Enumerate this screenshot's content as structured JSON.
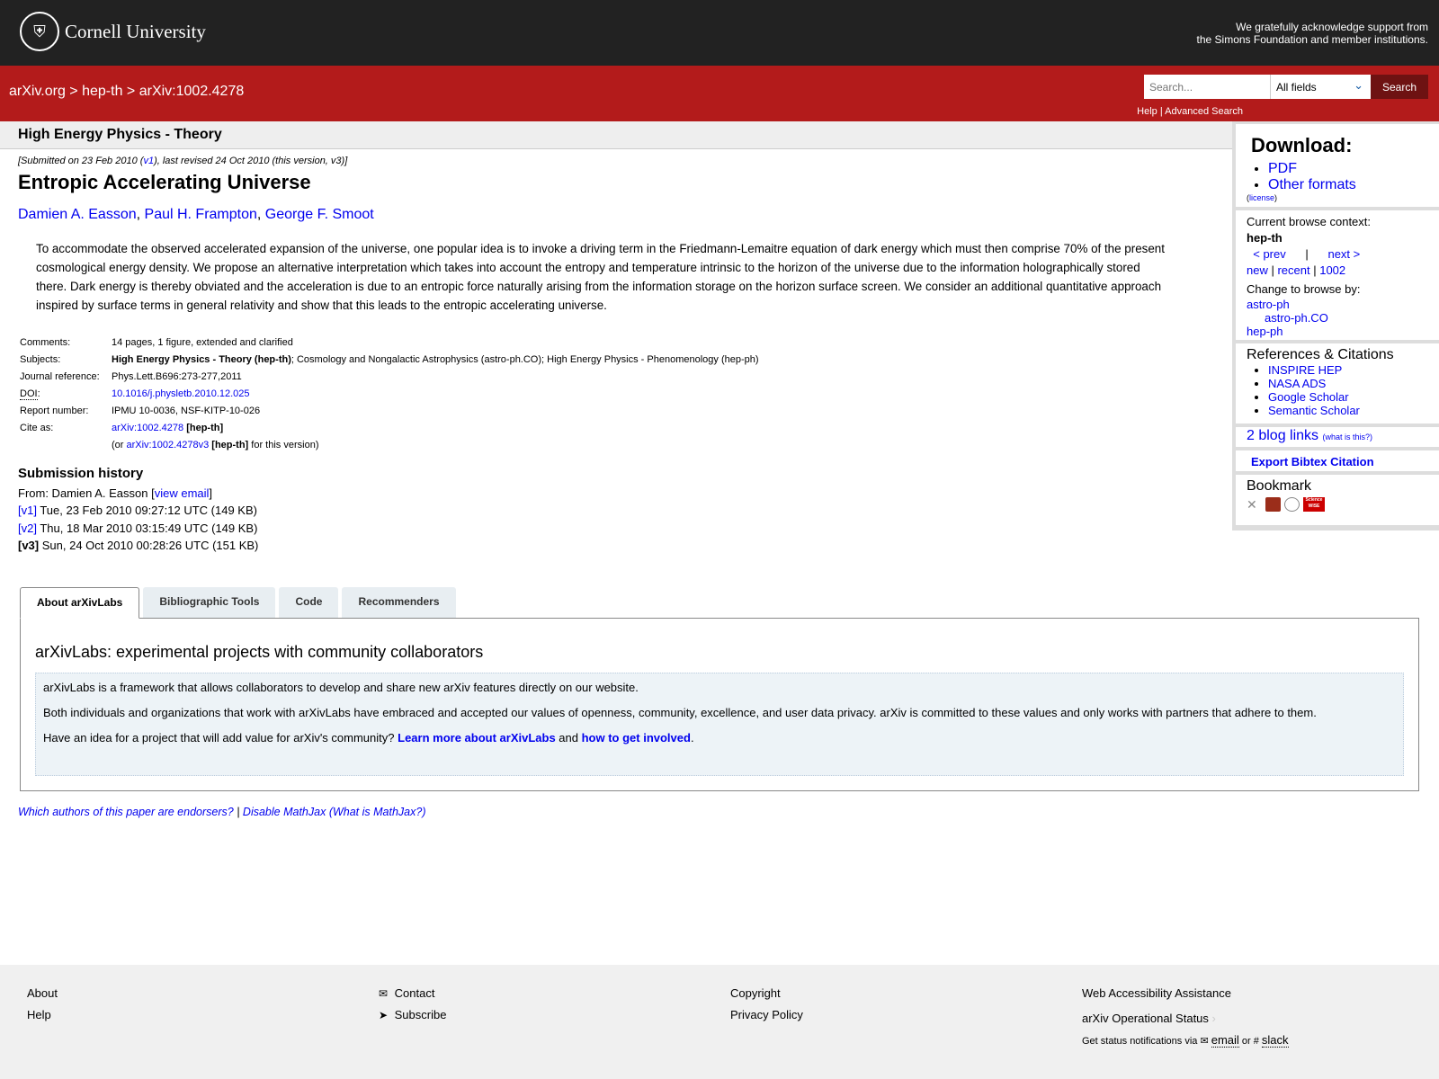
{
  "header": {
    "logo_text": "Cornell University",
    "ack_line1": "We gratefully acknowledge support from",
    "ack_line2": "the Simons Foundation and member institutions."
  },
  "nav": {
    "crumb1": "arXiv.org",
    "crumb2": "hep-th",
    "crumb3": "arXiv:1002.4278",
    "sep": ">",
    "search_placeholder": "Search...",
    "field_select": "All fields",
    "search_button": "Search",
    "help": "Help",
    "advanced": "Advanced Search"
  },
  "paper": {
    "category": "High Energy Physics - Theory",
    "dateline_pre": "[Submitted on 23 Feb 2010 (",
    "dateline_v1": "v1",
    "dateline_post": "), last revised 24 Oct 2010 (this version, v3)]",
    "title": "Entropic Accelerating Universe",
    "authors": [
      "Damien A. Easson",
      "Paul H. Frampton",
      "George F. Smoot"
    ],
    "abstract": "To accommodate the observed accelerated expansion of the universe, one popular idea is to invoke a driving term in the Friedmann-Lemaitre equation of dark energy which must then comprise 70% of the present cosmological energy density. We propose an alternative interpretation which takes into account the entropy and temperature intrinsic to the horizon of the universe due to the information holographically stored there. Dark energy is thereby obviated and the acceleration is due to an entropic force naturally arising from the information storage on the horizon surface screen. We consider an additional quantitative approach inspired by surface terms in general relativity and show that this leads to the entropic accelerating universe."
  },
  "meta": {
    "comments_label": "Comments:",
    "comments": "14 pages, 1 figure, extended and clarified",
    "subjects_label": "Subjects:",
    "subjects_primary": "High Energy Physics - Theory (hep-th)",
    "subjects_rest": "; Cosmology and Nongalactic Astrophysics (astro-ph.CO); High Energy Physics - Phenomenology (hep-ph)",
    "journal_label": "Journal reference:",
    "journal": "Phys.Lett.B696:273-277,2011",
    "doi_label": "DOI",
    "doi": "10.1016/j.physletb.2010.12.025",
    "report_label": "Report number:",
    "report": "IPMU 10-0036, NSF-KITP-10-026",
    "cite_label": "Cite as:",
    "cite_id": "arXiv:1002.4278",
    "cite_cat": "[hep-th]",
    "cite2_pre": "(or ",
    "cite2_id": "arXiv:1002.4278v3",
    "cite2_cat": "[hep-th]",
    "cite2_post": " for this version)"
  },
  "history": {
    "title": "Submission history",
    "from": "From: Damien A. Easson [",
    "view_email": "view email",
    "versions": [
      {
        "v": "[v1]",
        "text": " Tue, 23 Feb 2010 09:27:12 UTC (149 KB)"
      },
      {
        "v": "[v2]",
        "text": " Thu, 18 Mar 2010 03:15:49 UTC (149 KB)"
      },
      {
        "v": "[v3]",
        "text": " Sun, 24 Oct 2010 00:28:26 UTC (151 KB)"
      }
    ]
  },
  "tabs": [
    "About arXivLabs",
    "Bibliographic Tools",
    "Code",
    "Recommenders"
  ],
  "labs": {
    "title": "arXivLabs: experimental projects with community collaborators",
    "p1": "arXivLabs is a framework that allows collaborators to develop and share new arXiv features directly on our website.",
    "p2": "Both individuals and organizations that work with arXivLabs have embraced and accepted our values of openness, community, excellence, and user data privacy. arXiv is committed to these values and only works with partners that adhere to them.",
    "p3_pre": "Have an idea for a project that will add value for arXiv's community? ",
    "link1": "Learn more about arXivLabs",
    "and": " and ",
    "link2": "how to get involved",
    "end": "."
  },
  "endorse": {
    "l1": "Which authors of this paper are endorsers?",
    "sep": " | ",
    "l2": "Disable MathJax",
    "l3": "(What is MathJax?)"
  },
  "sidebar": {
    "download": "Download:",
    "pdf": "PDF",
    "other": "Other formats",
    "license": "license",
    "ctx_label": "Current browse context:",
    "ctx": "hep-th",
    "prev": "< prev",
    "bar": "|",
    "next": "next >",
    "new": "new",
    "recent": "recent",
    "month": "1002",
    "change": "Change to browse by:",
    "browse": [
      "astro-ph",
      "astro-ph.CO",
      "hep-ph"
    ],
    "refs_title": "References & Citations",
    "refs": [
      "INSPIRE HEP",
      "NASA ADS",
      "Google Scholar",
      "Semantic Scholar"
    ],
    "blog": "2 blog links",
    "whatis": "(what is this?)",
    "bibtex": "Export Bibtex Citation",
    "bookmark": "Bookmark",
    "bookmark_icons": [
      "bibsonomy-icon",
      "mendeley-icon",
      "reddit-icon",
      "sciencewise-icon"
    ],
    "sciencewise": "Science WISE"
  },
  "footer": {
    "about": "About",
    "help": "Help",
    "contact": "Contact",
    "subscribe": "Subscribe",
    "copyright": "Copyright",
    "privacy": "Privacy Policy",
    "accessibility": "Web Accessibility Assistance",
    "status": "arXiv Operational Status",
    "notify": "Get status notifications via",
    "email": "email",
    "or": "or",
    "slack": "slack"
  },
  "colors": {
    "header": "#222222",
    "brand_red": "#b31b1b",
    "search_button": "#6e1212",
    "link": "#0000ee"
  }
}
